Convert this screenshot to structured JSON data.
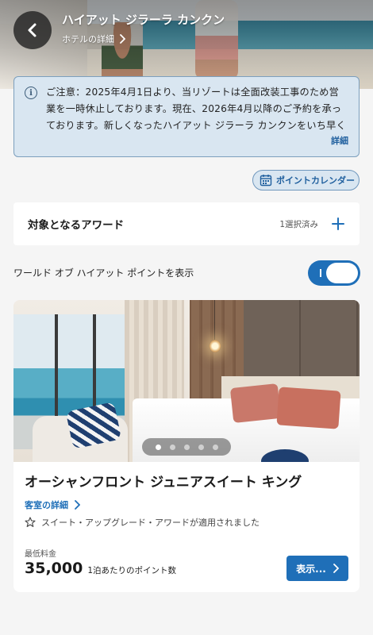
{
  "header": {
    "hotel_name": "ハイアット ジラーラ カンクン",
    "hotel_details_link": "ホテルの詳細"
  },
  "notice": {
    "text": "ご注意：2025年4月1日より、当リゾートは全面改装工事のため営業を一時休止しております。現在、2026年4月以降のご予約を承っております。新しくなったハイアット ジラーラ カンクンをいち早くご体験…",
    "more_label": "詳細"
  },
  "points_calendar": {
    "label": "ポイントカレンダー"
  },
  "award_filter": {
    "title": "対象となるアワード",
    "selected_count": "1選択済み"
  },
  "points_toggle": {
    "label": "ワールド オブ ハイアット ポイントを表示",
    "on": true
  },
  "room": {
    "name": "オーシャンフロント ジュニアスイート キング",
    "details_link": "客室の詳細",
    "upgrade_note": "スイート・アップグレード・アワードが適用されました",
    "min_rate_label": "最低料金",
    "price": "35,000",
    "price_unit": "1泊あたりのポイント数",
    "view_button": "表示...",
    "carousel": {
      "total": 5,
      "active_index": 0
    }
  },
  "colors": {
    "accent": "#1f6fb8",
    "notice_bg": "#d9e6f1",
    "page_bg": "#f5f5f5"
  }
}
